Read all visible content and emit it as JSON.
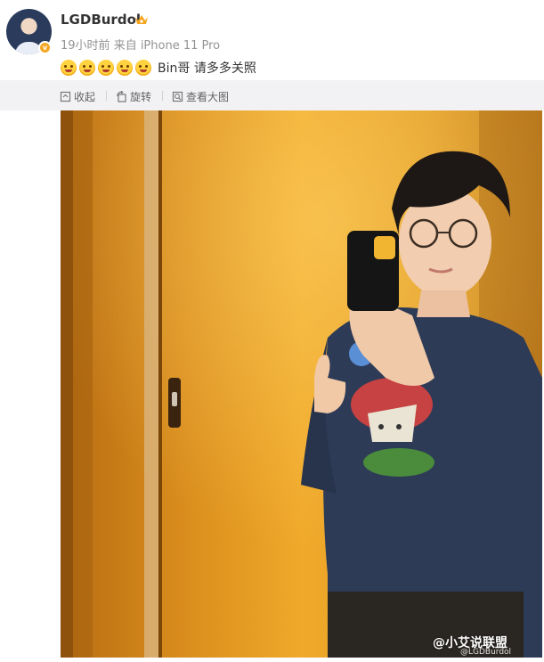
{
  "post": {
    "username": "LGDBurdol",
    "time": "19小时前",
    "source": "来自 iPhone 11 Pro",
    "emojis": [
      "thinking-emoji",
      "pleading-emoji",
      "cold-sweat-emoji",
      "smile-emoji",
      "star-struck-emoji"
    ],
    "text": "Bin哥 请多多关照"
  },
  "toolbar": {
    "collapse_label": "收起",
    "rotate_label": "旋转",
    "view_large_label": "查看大图"
  },
  "watermark": {
    "main": "@小艾说联盟",
    "sub": "@LGDBurdol"
  },
  "colors": {
    "toolbar_bg": "#f2f2f5",
    "wall_orange": "#f2ad2c",
    "shirt_navy": "#2e3b57"
  }
}
